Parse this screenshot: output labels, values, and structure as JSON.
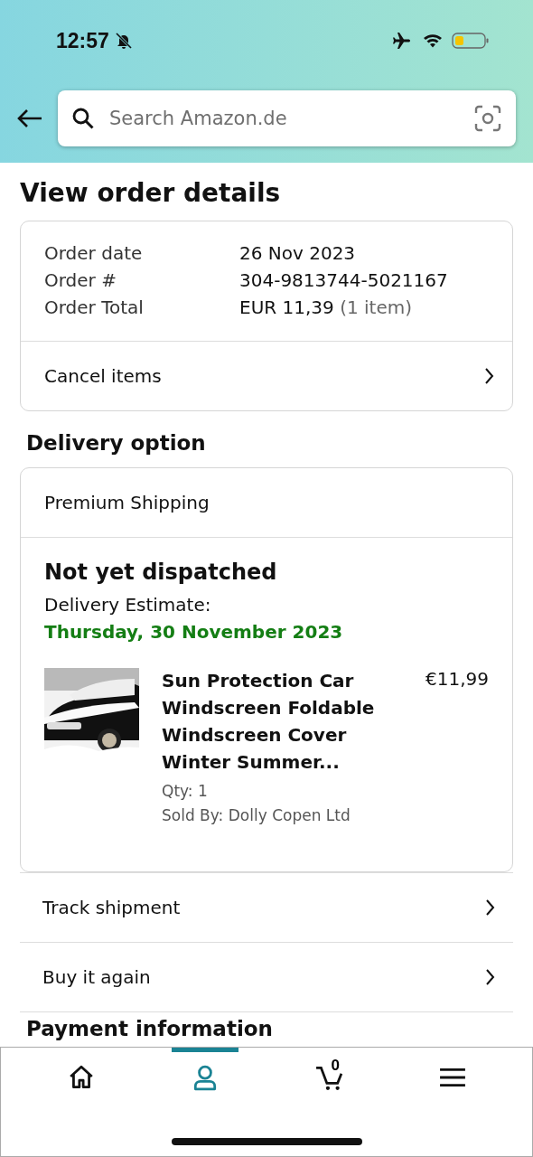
{
  "status_bar": {
    "time": "12:57"
  },
  "search": {
    "placeholder": "Search Amazon.de"
  },
  "title": "View order details",
  "order_summary": {
    "rows": [
      {
        "label": "Order date",
        "value": "26 Nov 2023"
      },
      {
        "label": "Order #",
        "value": "304-9813744-5021167"
      },
      {
        "label": "Order Total",
        "value": "EUR 11,39",
        "note": "(1 item)"
      }
    ],
    "action": "Cancel items"
  },
  "delivery": {
    "heading": "Delivery option",
    "option": "Premium Shipping",
    "status": "Not yet dispatched",
    "estimate_label": "Delivery Estimate:",
    "estimate_date": "Thursday, 30 November 2023",
    "item": {
      "kind": "picture",
      "name": "Sun Protection Car Windscreen Foldable Windscreen Cover Winter Summer...",
      "price": "€11,99",
      "qty": "Qty: 1",
      "seller": "Sold By: Dolly Copen Ltd"
    }
  },
  "actions": [
    "Track shipment",
    "Buy it again"
  ],
  "next_heading": "Payment information",
  "tab_bar": [
    {
      "kind": "home",
      "selected": false
    },
    {
      "kind": "account",
      "selected": true
    },
    {
      "kind": "cart",
      "selected": false,
      "count": "0"
    },
    {
      "kind": "menu",
      "selected": false
    }
  ]
}
